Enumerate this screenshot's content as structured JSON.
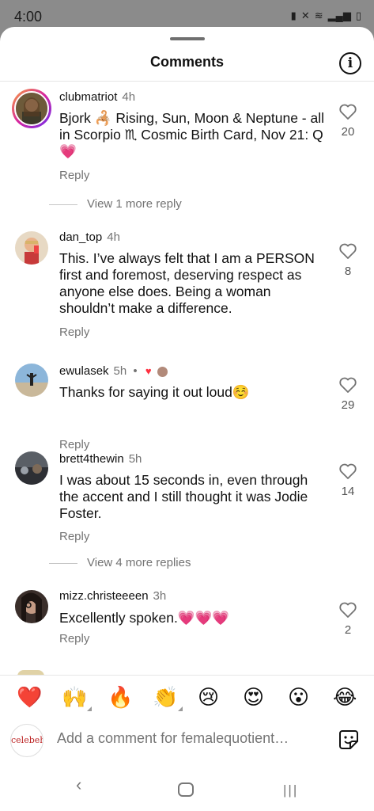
{
  "status_bar": {
    "time": "4:00"
  },
  "sheet": {
    "title": "Comments"
  },
  "comments": [
    {
      "username": "clubmatriot",
      "time": "4h",
      "text": "Bjork 🦂 Rising, Sun, Moon & Neptune - all in Scorpio ♏ Cosmic Birth Card, Nov 21: Q💗",
      "reply": "Reply",
      "likes": "20",
      "view_more": "View 1 more reply"
    },
    {
      "username": "dan_top",
      "time": "4h",
      "text": "This. I’ve always felt that I am a PERSON first and foremost, deserving respect as anyone else does. Being a woman shouldn’t make a difference.",
      "reply": "Reply",
      "likes": "8"
    },
    {
      "username": "ewulasek",
      "time": "5h",
      "separator": "•",
      "text": "Thanks for saying it out loud☺️",
      "reply": "Reply",
      "likes": "29"
    },
    {
      "username": "brett4thewin",
      "time": "5h",
      "text": "I was about 15 seconds in, even through the accent and I still thought it was Jodie Foster.",
      "reply": "Reply",
      "likes": "14",
      "view_more": "View 4 more replies"
    },
    {
      "username": "mizz.christeeeen",
      "time": "3h",
      "text": "Excellently spoken.💗💗💗",
      "reply": "Reply",
      "likes": "2"
    }
  ],
  "emoji_bar": [
    "❤️",
    "🙌",
    "🔥",
    "👏",
    "😢",
    "😍",
    "😮",
    "😂"
  ],
  "input": {
    "avatar_text": "celebeh",
    "placeholder": "Add a comment for femalequotient…"
  },
  "colors": {
    "heart_red": "#ff3040",
    "secondary_text": "#737373"
  }
}
